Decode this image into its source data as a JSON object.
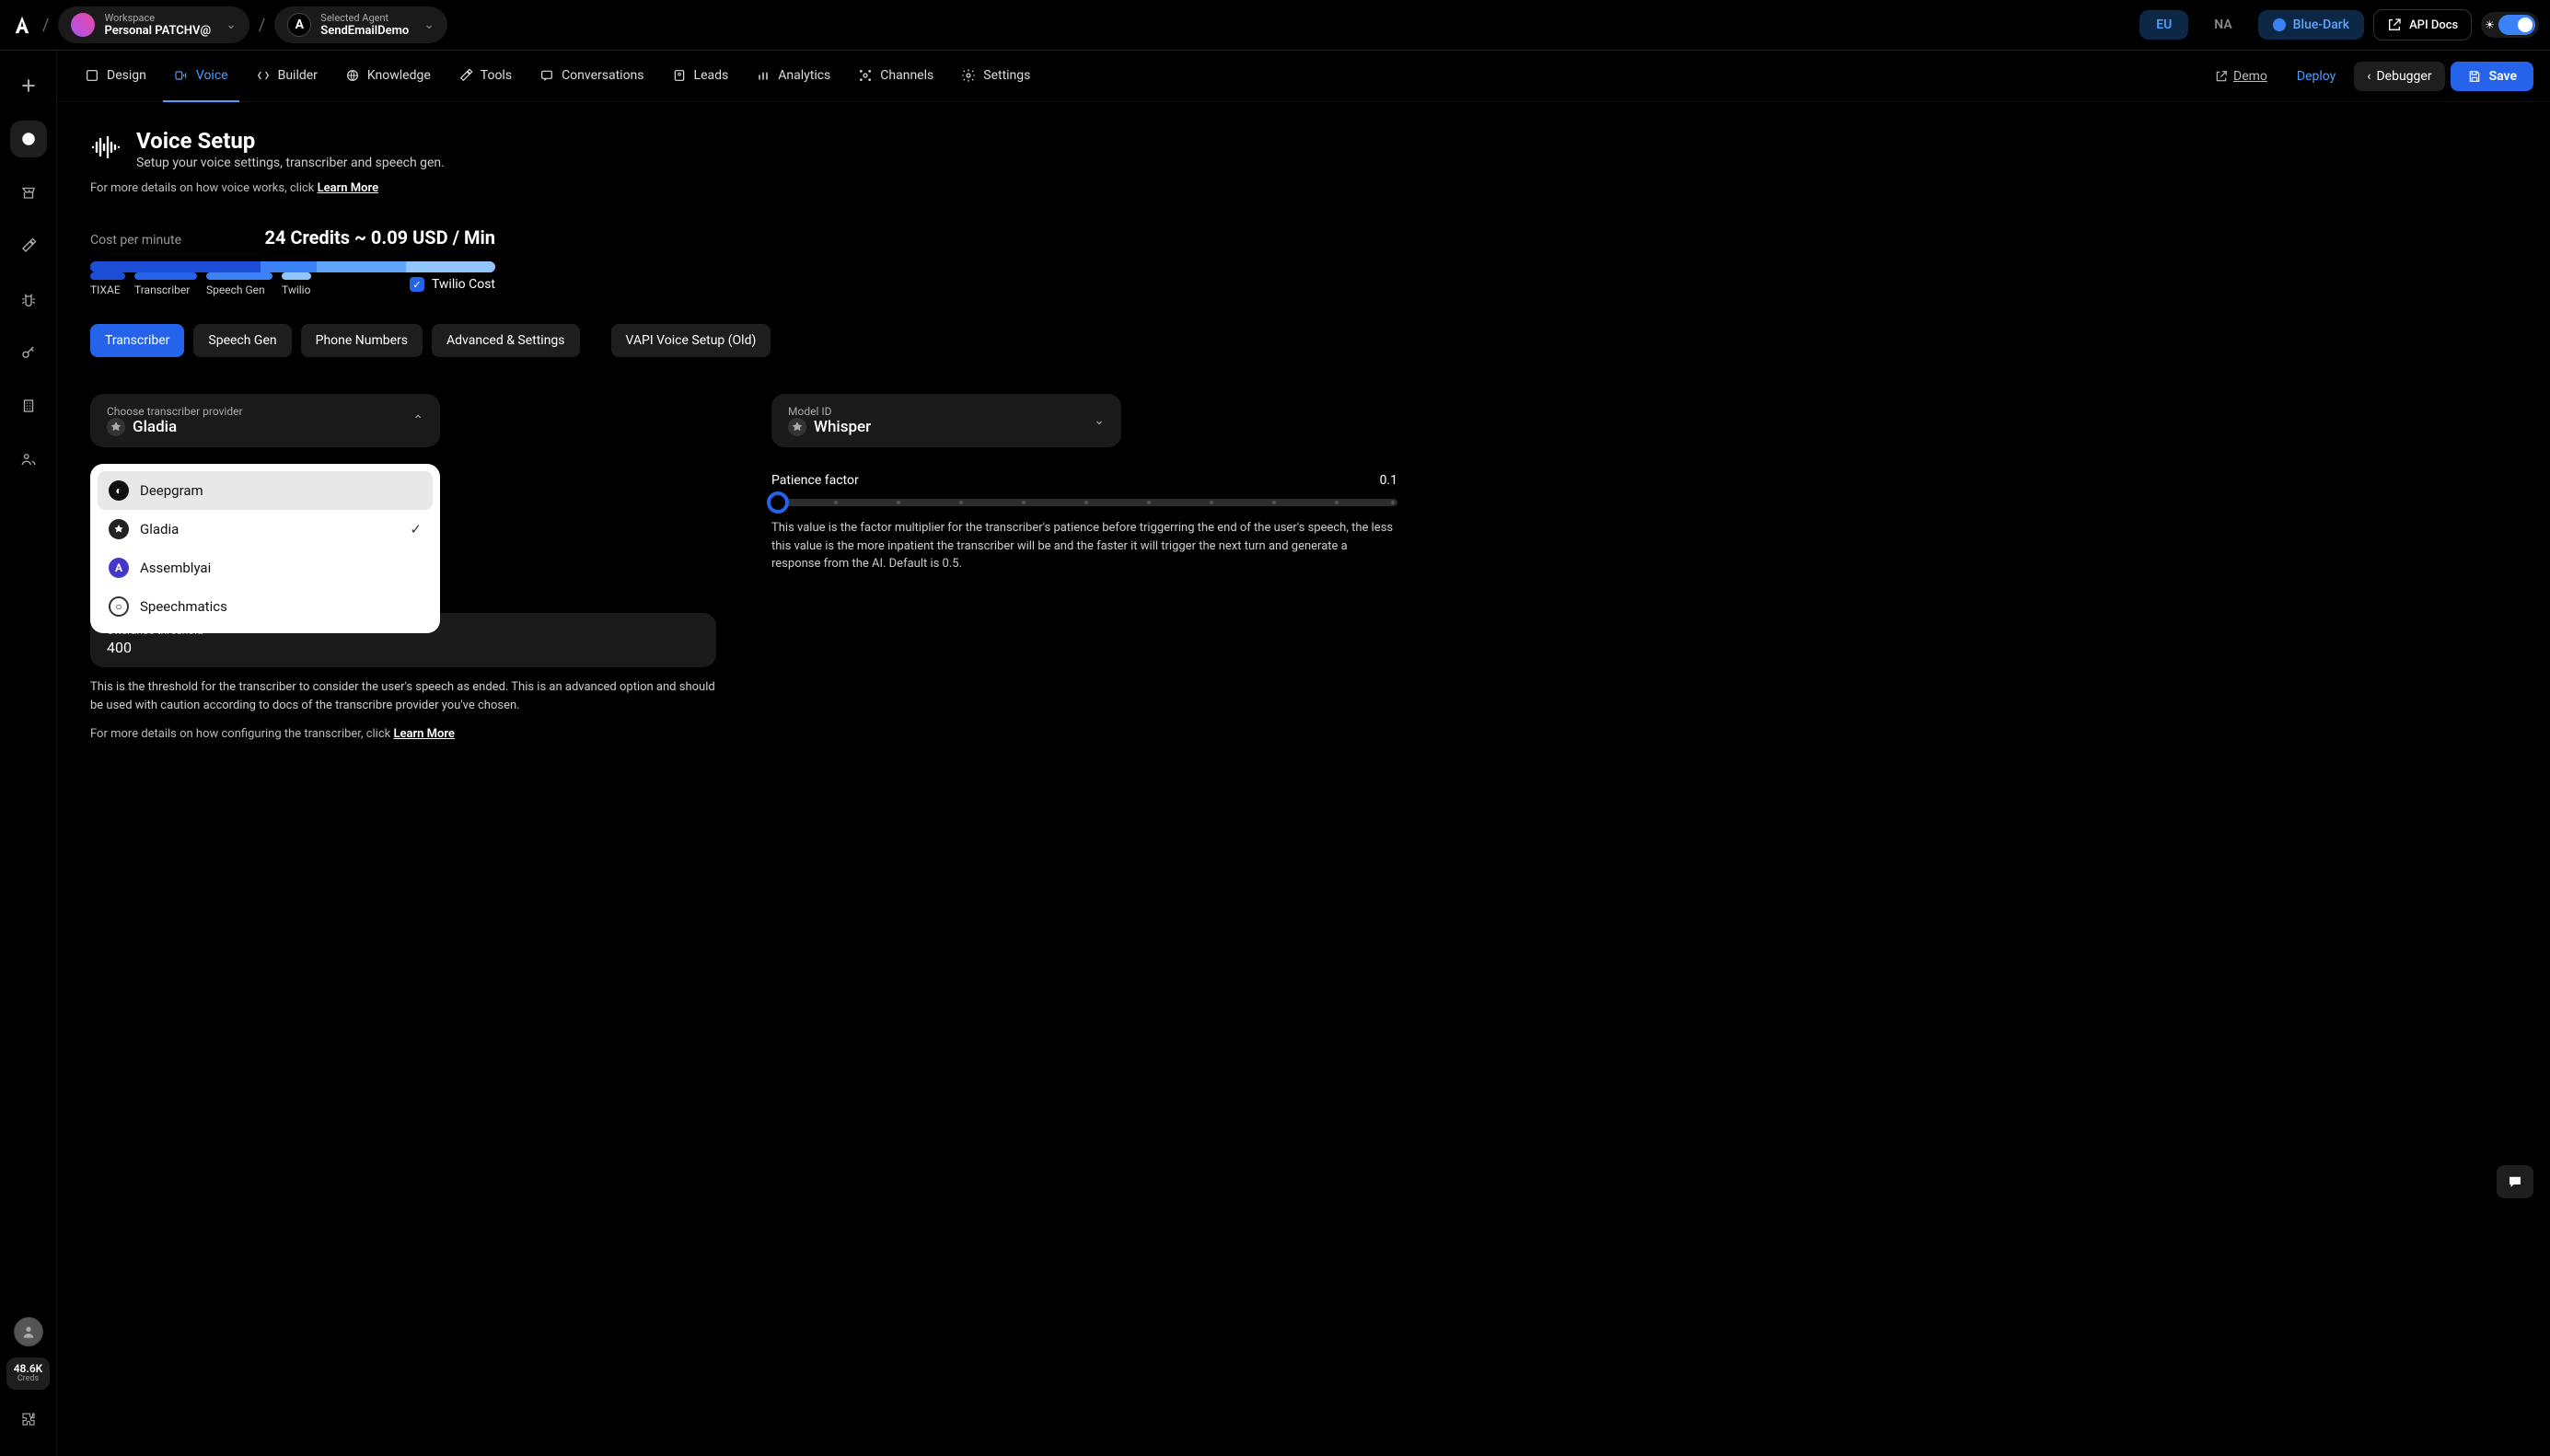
{
  "header": {
    "workspace_label": "Workspace",
    "workspace_value": "Personal PATCHV@",
    "agent_label": "Selected Agent",
    "agent_value": "SendEmailDemo",
    "region_eu": "EU",
    "region_na": "NA",
    "theme": "Blue-Dark",
    "api_docs": "API Docs"
  },
  "tabs": {
    "design": "Design",
    "voice": "Voice",
    "builder": "Builder",
    "knowledge": "Knowledge",
    "tools": "Tools",
    "conversations": "Conversations",
    "leads": "Leads",
    "analytics": "Analytics",
    "channels": "Channels",
    "settings": "Settings",
    "demo": "Demo",
    "deploy": "Deploy",
    "debugger": "Debugger",
    "save": "Save"
  },
  "page": {
    "title": "Voice Setup",
    "subtitle": "Setup your voice settings, transcriber and speech gen.",
    "help_prefix": "For more details on how voice works, click ",
    "help_link": "Learn More"
  },
  "cost": {
    "label": "Cost per minute",
    "value": "24 Credits ~ 0.09 USD / Min",
    "legend_tixae": "TIXAE",
    "legend_transcriber": "Transcriber",
    "legend_speech": "Speech Gen",
    "legend_twilio": "Twilio",
    "twilio_cost": "Twilio Cost"
  },
  "subtabs": {
    "transcriber": "Transcriber",
    "speech_gen": "Speech Gen",
    "phone_numbers": "Phone Numbers",
    "advanced": "Advanced & Settings",
    "vapi": "VAPI Voice Setup (Old)"
  },
  "provider": {
    "label": "Choose transcriber provider",
    "selected": "Gladia",
    "options": {
      "deepgram": "Deepgram",
      "gladia": "Gladia",
      "assemblyai": "Assemblyai",
      "speechmatics": "Speechmatics"
    }
  },
  "model": {
    "label": "Model ID",
    "value": "Whisper"
  },
  "patience": {
    "label": "Patience factor",
    "value": "0.1",
    "desc": "This value is the factor multiplier for the transcriber's patience before triggerring the end of the user's speech, the less this value is the more inpatient the transcriber will be and the faster it will trigger the next turn and generate a response from the AI. Default is 0.5."
  },
  "utterance": {
    "label": "Utterance threshold",
    "value": "400",
    "desc": "This is the threshold for the transcriber to consider the user's speech as ended. This is an advanced option and should be used with caution according to docs of the transcribre provider you've chosen.",
    "help_prefix": "For more details on how configuring the transcriber, click ",
    "help_link": "Learn More"
  },
  "rail": {
    "creds_num": "48.6K",
    "creds_lbl": "Creds"
  }
}
